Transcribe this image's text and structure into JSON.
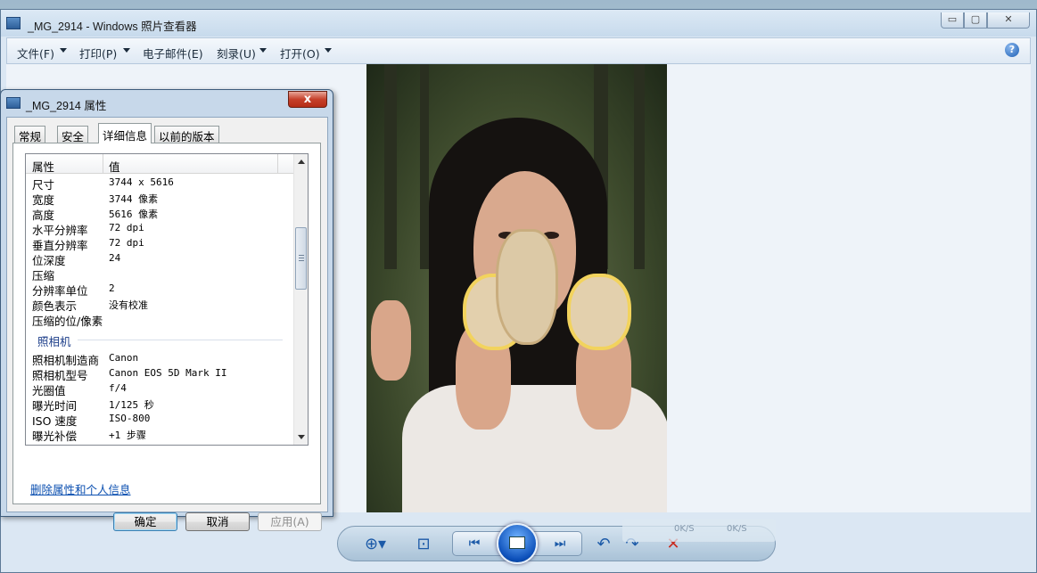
{
  "viewer": {
    "title": "_MG_2914 - Windows 照片查看器",
    "menu": [
      {
        "label": "文件(F)",
        "has_arrow": true
      },
      {
        "label": "打印(P)",
        "has_arrow": true
      },
      {
        "label": "电子邮件(E)",
        "has_arrow": false
      },
      {
        "label": "刻录(U)",
        "has_arrow": true
      },
      {
        "label": "打开(O)",
        "has_arrow": true
      }
    ],
    "help_glyph": "?",
    "window_buttons": {
      "minimize": "▭",
      "maximize": "▢",
      "close": "✕"
    }
  },
  "controls": {
    "zoom_icon": "zoom-icon",
    "fit_icon": "actual-size-icon",
    "prev_icon": "previous-icon",
    "slideshow_icon": "slideshow-icon",
    "next_icon": "next-icon",
    "rotate_ccw_icon": "rotate-counterclockwise-icon",
    "rotate_cw_icon": "rotate-clockwise-icon",
    "delete_icon": "delete-icon"
  },
  "network_overlay": {
    "upload": "0K/S",
    "download": "0K/S"
  },
  "dialog": {
    "title": "_MG_2914 属性",
    "close_glyph": "x",
    "tabs": [
      "常规",
      "安全",
      "详细信息",
      "以前的版本"
    ],
    "active_tab": "详细信息",
    "header": {
      "property": "属性",
      "value": "值"
    },
    "rows": [
      {
        "prop": "尺寸",
        "val": "3744 x 5616"
      },
      {
        "prop": "宽度",
        "val": "3744 像素"
      },
      {
        "prop": "高度",
        "val": "5616 像素"
      },
      {
        "prop": "水平分辨率",
        "val": "72 dpi"
      },
      {
        "prop": "垂直分辨率",
        "val": "72 dpi"
      },
      {
        "prop": "位深度",
        "val": "24"
      },
      {
        "prop": "压缩",
        "val": ""
      },
      {
        "prop": "分辨率单位",
        "val": "2"
      },
      {
        "prop": "颜色表示",
        "val": "没有校准"
      },
      {
        "prop": "压缩的位/像素",
        "val": ""
      }
    ],
    "group_camera": "照相机",
    "camera_rows": [
      {
        "prop": "照相机制造商",
        "val": "Canon"
      },
      {
        "prop": "照相机型号",
        "val": "Canon EOS 5D Mark II"
      },
      {
        "prop": "光圈值",
        "val": "f/4"
      },
      {
        "prop": "曝光时间",
        "val": "1/125 秒"
      },
      {
        "prop": "ISO 速度",
        "val": "ISO-800"
      },
      {
        "prop": "曝光补偿",
        "val": "+1 步骤"
      }
    ],
    "remove_link": "删除属性和个人信息",
    "buttons": {
      "ok": "确定",
      "cancel": "取消",
      "apply": "应用(A)"
    }
  },
  "colors": {
    "accent": "#1c5aa8",
    "link": "#0b4fb0",
    "close_red": "#c6402a"
  }
}
